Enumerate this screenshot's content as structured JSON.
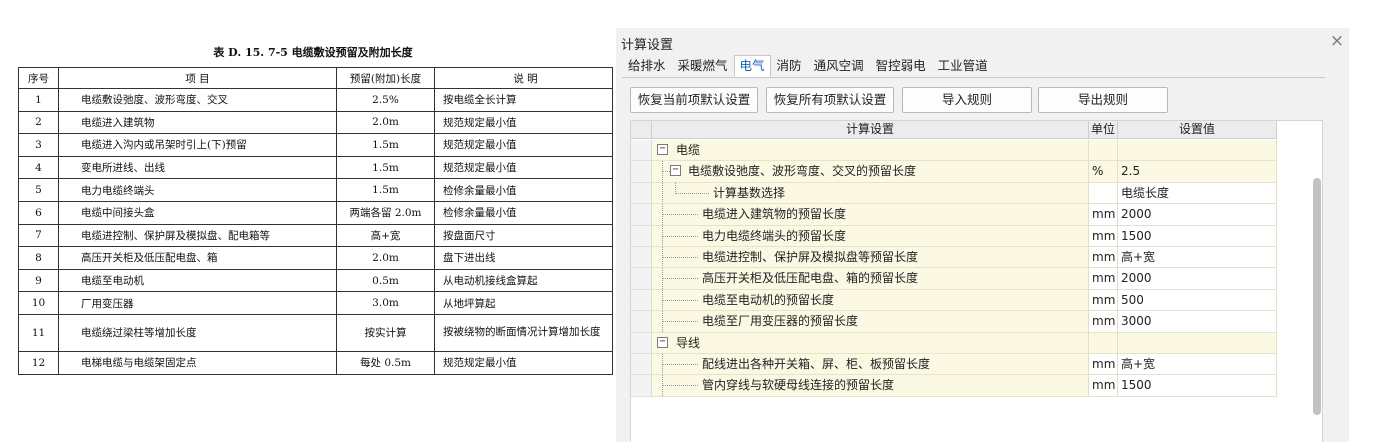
{
  "doc": {
    "caption": "表 D. 15. 7-5   电缆敷设预留及附加长度",
    "headers": [
      "序号",
      "项        目",
      "预留(附加)长度",
      "说        明"
    ],
    "rows": [
      [
        "1",
        "电缆敷设弛度、波形弯度、交叉",
        "2.5%",
        "按电缆全长计算"
      ],
      [
        "2",
        "电缆进入建筑物",
        "2.0m",
        "规范规定最小值"
      ],
      [
        "3",
        "电缆进入沟内或吊架时引上(下)预留",
        "1.5m",
        "规范规定最小值"
      ],
      [
        "4",
        "变电所进线、出线",
        "1.5m",
        "规范规定最小值"
      ],
      [
        "5",
        "电力电缆终端头",
        "1.5m",
        "检修余量最小值"
      ],
      [
        "6",
        "电缆中间接头盒",
        "两端各留 2.0m",
        "检修余量最小值"
      ],
      [
        "7",
        "电缆进控制、保护屏及模拟盘、配电箱等",
        "高+宽",
        "按盘面尺寸"
      ],
      [
        "8",
        "高压开关柜及低压配电盘、箱",
        "2.0m",
        "盘下进出线"
      ],
      [
        "9",
        "电缆至电动机",
        "0.5m",
        "从电动机接线盒算起"
      ],
      [
        "10",
        "厂用变压器",
        "3.0m",
        "从地坪算起"
      ],
      [
        "11",
        "电缆绕过梁柱等增加长度",
        "按实计算",
        "按被绕物的断面情况计算增加长度"
      ],
      [
        "12",
        "电梯电缆与电缆架固定点",
        "每处 0.5m",
        "规范规定最小值"
      ]
    ]
  },
  "dialog": {
    "title": "计算设置",
    "close_glyph": "×",
    "tabs": [
      {
        "label": "给排水",
        "active": false
      },
      {
        "label": "采暖燃气",
        "active": false
      },
      {
        "label": "电气",
        "active": true
      },
      {
        "label": "消防",
        "active": false
      },
      {
        "label": "通风空调",
        "active": false
      },
      {
        "label": "智控弱电",
        "active": false
      },
      {
        "label": "工业管道",
        "active": false
      }
    ],
    "buttons": {
      "restore_current": "恢复当前项默认设置",
      "restore_all": "恢复所有项默认设置",
      "import": "导入规则",
      "export": "导出规则"
    },
    "grid": {
      "headers": {
        "name": "计算设置",
        "unit": "单位",
        "value": "设置值"
      },
      "rows": [
        {
          "level": 0,
          "kind": "group",
          "toggle": "−",
          "name": "电缆",
          "unit": "",
          "value": ""
        },
        {
          "level": 1,
          "kind": "group",
          "toggle": "−",
          "name": "电缆敷设弛度、波形弯度、交叉的预留长度",
          "unit": "%",
          "value": "2.5"
        },
        {
          "level": 2,
          "kind": "item",
          "name": "计算基数选择",
          "unit": "",
          "value": "电缆长度"
        },
        {
          "level": 1,
          "kind": "item",
          "name": "电缆进入建筑物的预留长度",
          "unit": "mm",
          "value": "2000"
        },
        {
          "level": 1,
          "kind": "item",
          "name": "电力电缆终端头的预留长度",
          "unit": "mm",
          "value": "1500"
        },
        {
          "level": 1,
          "kind": "item",
          "name": "电缆进控制、保护屏及模拟盘等预留长度",
          "unit": "mm",
          "value": "高+宽"
        },
        {
          "level": 1,
          "kind": "item",
          "name": "高压开关柜及低压配电盘、箱的预留长度",
          "unit": "mm",
          "value": "2000"
        },
        {
          "level": 1,
          "kind": "item",
          "name": "电缆至电动机的预留长度",
          "unit": "mm",
          "value": "500"
        },
        {
          "level": 1,
          "kind": "item",
          "name": "电缆至厂用变压器的预留长度",
          "unit": "mm",
          "value": "3000"
        },
        {
          "level": 0,
          "kind": "group",
          "toggle": "−",
          "name": "导线",
          "unit": "",
          "value": ""
        },
        {
          "level": 1,
          "kind": "item",
          "name": "配线进出各种开关箱、屏、柜、板预留长度",
          "unit": "mm",
          "value": "高+宽"
        },
        {
          "level": 1,
          "kind": "item",
          "name": "管内穿线与软硬母线连接的预留长度",
          "unit": "mm",
          "value": "1500"
        }
      ]
    }
  }
}
